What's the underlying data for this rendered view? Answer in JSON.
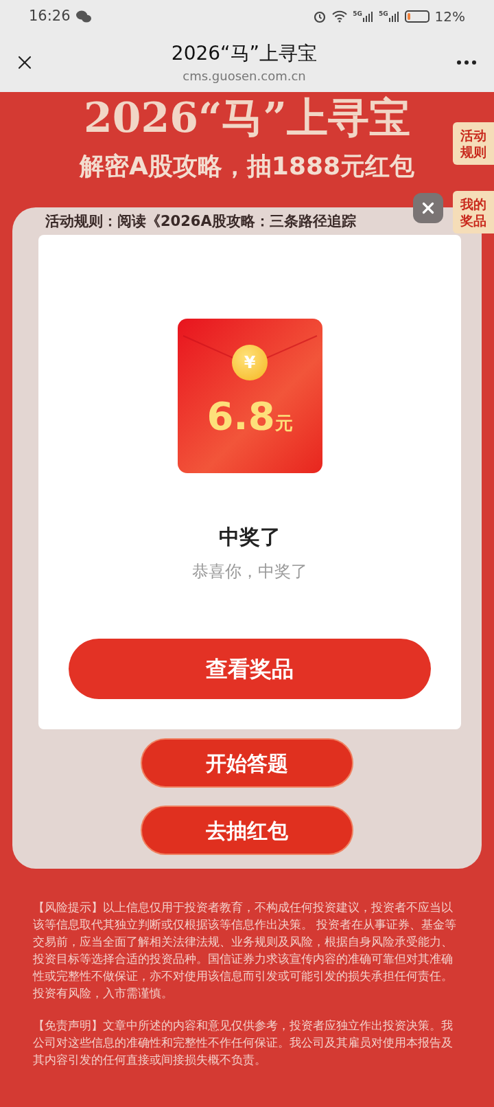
{
  "status_bar": {
    "time": "16:26",
    "network": [
      "5G",
      "5G"
    ],
    "battery": "12%"
  },
  "browser_bar": {
    "title": "2026“马”上寻宝",
    "url": "cms.guosen.com.cn"
  },
  "hero": {
    "title": "2026“马”上寻宝",
    "subtitle": "解密A股攻略，抽1888元红包"
  },
  "side_tabs": [
    "活动规则",
    "我的奖品"
  ],
  "card": {
    "rules": "活动规则：阅读《2026A股攻略：三条路径追踪",
    "buttons": [
      "开始答题",
      "去抽红包"
    ]
  },
  "disclaimers": [
    "【风险提示】以上信息仅用于投资者教育，不构成任何投资建议，投资者不应当以该等信息取代其独立判断或仅根据该等信息作出决策。 投资者在从事证券、基金等交易前，应当全面了解相关法律法规、业务规则及风险，根据自身风险承受能力、投资目标等选择合适的投资品种。国信证券力求该宣传内容的准确可靠但对其准确性或完整性不做保证，亦不对使用该信息而引发或可能引发的损失承担任何责任。投资有风险，入市需谨慎。",
    "【免责声明】文章中所述的内容和意见仅供参考，投资者应独立作出投资决策。我公司对这些信息的准确性和完整性不作任何保证。我公司及其雇员对使用本报告及其内容引发的任何直接或间接损失概不负责。"
  ],
  "dialog": {
    "currency": "¥",
    "amount": "6.8",
    "unit": "元",
    "title": "中奖了",
    "message": "恭喜你，中奖了",
    "button": "查看奖品"
  }
}
